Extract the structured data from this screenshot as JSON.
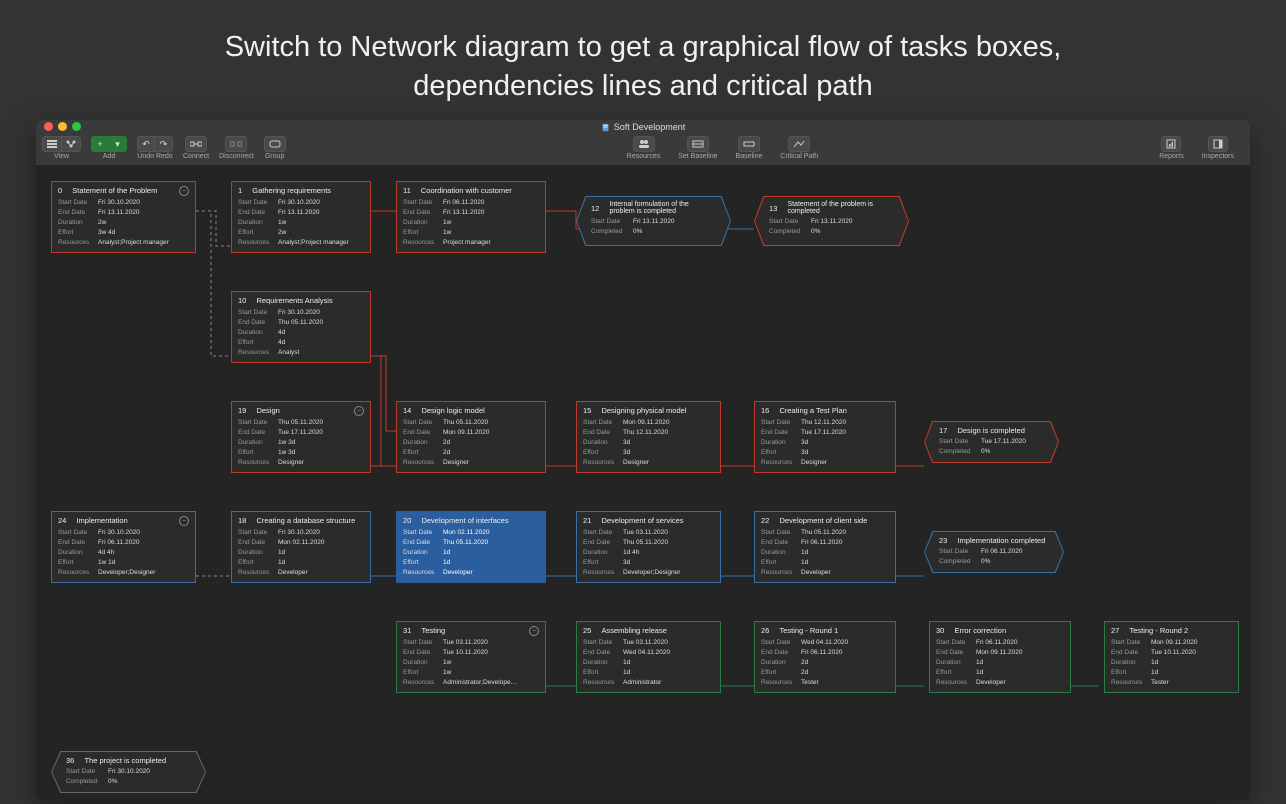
{
  "hero": "Switch to Network diagram to get a graphical flow of tasks boxes,\ndependencies lines and critical path",
  "window": {
    "title": "Soft Development"
  },
  "toolbar": {
    "view": "View",
    "add": "Add",
    "undo": "Undo",
    "redo": "Redo",
    "connect": "Connect",
    "disconnect": "Disconnect",
    "group": "Group",
    "resources": "Resources",
    "set_baseline": "Set Baseline",
    "baseline": "Baseline",
    "critical_path": "Critical Path",
    "reports": "Reports",
    "inspectors": "Inspectors"
  },
  "field_labels": {
    "start": "Start Date",
    "end": "End Date",
    "duration": "Duration",
    "effort": "Effort",
    "resources": "Resources",
    "completed": "Completed"
  },
  "nodes": {
    "n0": {
      "num": "0",
      "title": "Statement of the Problem",
      "start": "Fri 30.10.2020",
      "end": "Fri 13.11.2020",
      "duration": "2w",
      "effort": "3w 4d",
      "resources": "Analyst;Project manager"
    },
    "n1": {
      "num": "1",
      "title": "Gathering requirements",
      "start": "Fri 30.10.2020",
      "end": "Fri 13.11.2020",
      "duration": "1w",
      "effort": "2w",
      "resources": "Analyst;Project manager"
    },
    "n10": {
      "num": "10",
      "title": "Requirements Analysis",
      "start": "Fri 30.10.2020",
      "end": "Thu 05.11.2020",
      "duration": "4d",
      "effort": "4d",
      "resources": "Analyst"
    },
    "n11": {
      "num": "11",
      "title": "Coordination with customer",
      "start": "Fri 06.11.2020",
      "end": "Fri 13.11.2020",
      "duration": "1w",
      "effort": "1w",
      "resources": "Project manager"
    },
    "n12": {
      "num": "12",
      "title": "Internal formulation of the problem is completed",
      "start": "Fri 13.11.2020",
      "completed": "0%"
    },
    "n13": {
      "num": "13",
      "title": "Statement of the problem is completed",
      "start": "Fri 13.11.2020",
      "completed": "0%"
    },
    "n19": {
      "num": "19",
      "title": "Design",
      "start": "Thu 05.11.2020",
      "end": "Tue 17.11.2020",
      "duration": "1w 3d",
      "effort": "1w 3d",
      "resources": "Designer"
    },
    "n14": {
      "num": "14",
      "title": "Design logic model",
      "start": "Thu 05.11.2020",
      "end": "Mon 09.11.2020",
      "duration": "2d",
      "effort": "2d",
      "resources": "Designer"
    },
    "n15": {
      "num": "15",
      "title": "Designing physical model",
      "start": "Mon 09.11.2020",
      "end": "Thu 12.11.2020",
      "duration": "3d",
      "effort": "3d",
      "resources": "Designer"
    },
    "n16": {
      "num": "16",
      "title": "Creating a Test Plan",
      "start": "Thu 12.11.2020",
      "end": "Tue 17.11.2020",
      "duration": "3d",
      "effort": "3d",
      "resources": "Designer"
    },
    "n17": {
      "num": "17",
      "title": "Design is completed",
      "start": "Tue 17.11.2020",
      "completed": "0%"
    },
    "n24": {
      "num": "24",
      "title": "Implementation",
      "start": "Fri 30.10.2020",
      "end": "Fri 06.11.2020",
      "duration": "4d 4h",
      "effort": "1w 1d",
      "resources": "Developer;Designer"
    },
    "n18": {
      "num": "18",
      "title": "Creating a database structure",
      "start": "Fri 30.10.2020",
      "end": "Mon 02.11.2020",
      "duration": "1d",
      "effort": "1d",
      "resources": "Developer"
    },
    "n20": {
      "num": "20",
      "title": "Development of interfaces",
      "start": "Mon 02.11.2020",
      "end": "Thu 05.11.2020",
      "duration": "1d",
      "effort": "1d",
      "resources": "Developer"
    },
    "n21": {
      "num": "21",
      "title": "Development of services",
      "start": "Tue 03.11.2020",
      "end": "Thu 05.11.2020",
      "duration": "1d 4h",
      "effort": "3d",
      "resources": "Developer;Designer"
    },
    "n22": {
      "num": "22",
      "title": "Development of client side",
      "start": "Thu 05.11.2020",
      "end": "Fri 06.11.2020",
      "duration": "1d",
      "effort": "1d",
      "resources": "Developer"
    },
    "n23": {
      "num": "23",
      "title": "Implementation completed",
      "start": "Fri 06.11.2020",
      "completed": "0%"
    },
    "n31": {
      "num": "31",
      "title": "Testing",
      "start": "Tue 03.11.2020",
      "end": "Tue 10.11.2020",
      "duration": "1w",
      "effort": "1w",
      "resources": "Administrator;Develope…"
    },
    "n25": {
      "num": "25",
      "title": "Assembling release",
      "start": "Tue 03.11.2020",
      "end": "Wed 04.11.2020",
      "duration": "1d",
      "effort": "1d",
      "resources": "Administrator"
    },
    "n26": {
      "num": "26",
      "title": "Testing - Round 1",
      "start": "Wed 04.11.2020",
      "end": "Fri 06.11.2020",
      "duration": "2d",
      "effort": "2d",
      "resources": "Tester"
    },
    "n30": {
      "num": "30",
      "title": "Error correction",
      "start": "Fri 06.11.2020",
      "end": "Mon 09.11.2020",
      "duration": "1d",
      "effort": "1d",
      "resources": "Developer"
    },
    "n27": {
      "num": "27",
      "title": "Testing - Round 2",
      "start": "Mon 09.11.2020",
      "end": "Tue 10.11.2020",
      "duration": "1d",
      "effort": "1d",
      "resources": "Tester"
    },
    "n36": {
      "num": "36",
      "title": "The project is completed",
      "start": "Fri 30.10.2020",
      "completed": "0%"
    }
  }
}
